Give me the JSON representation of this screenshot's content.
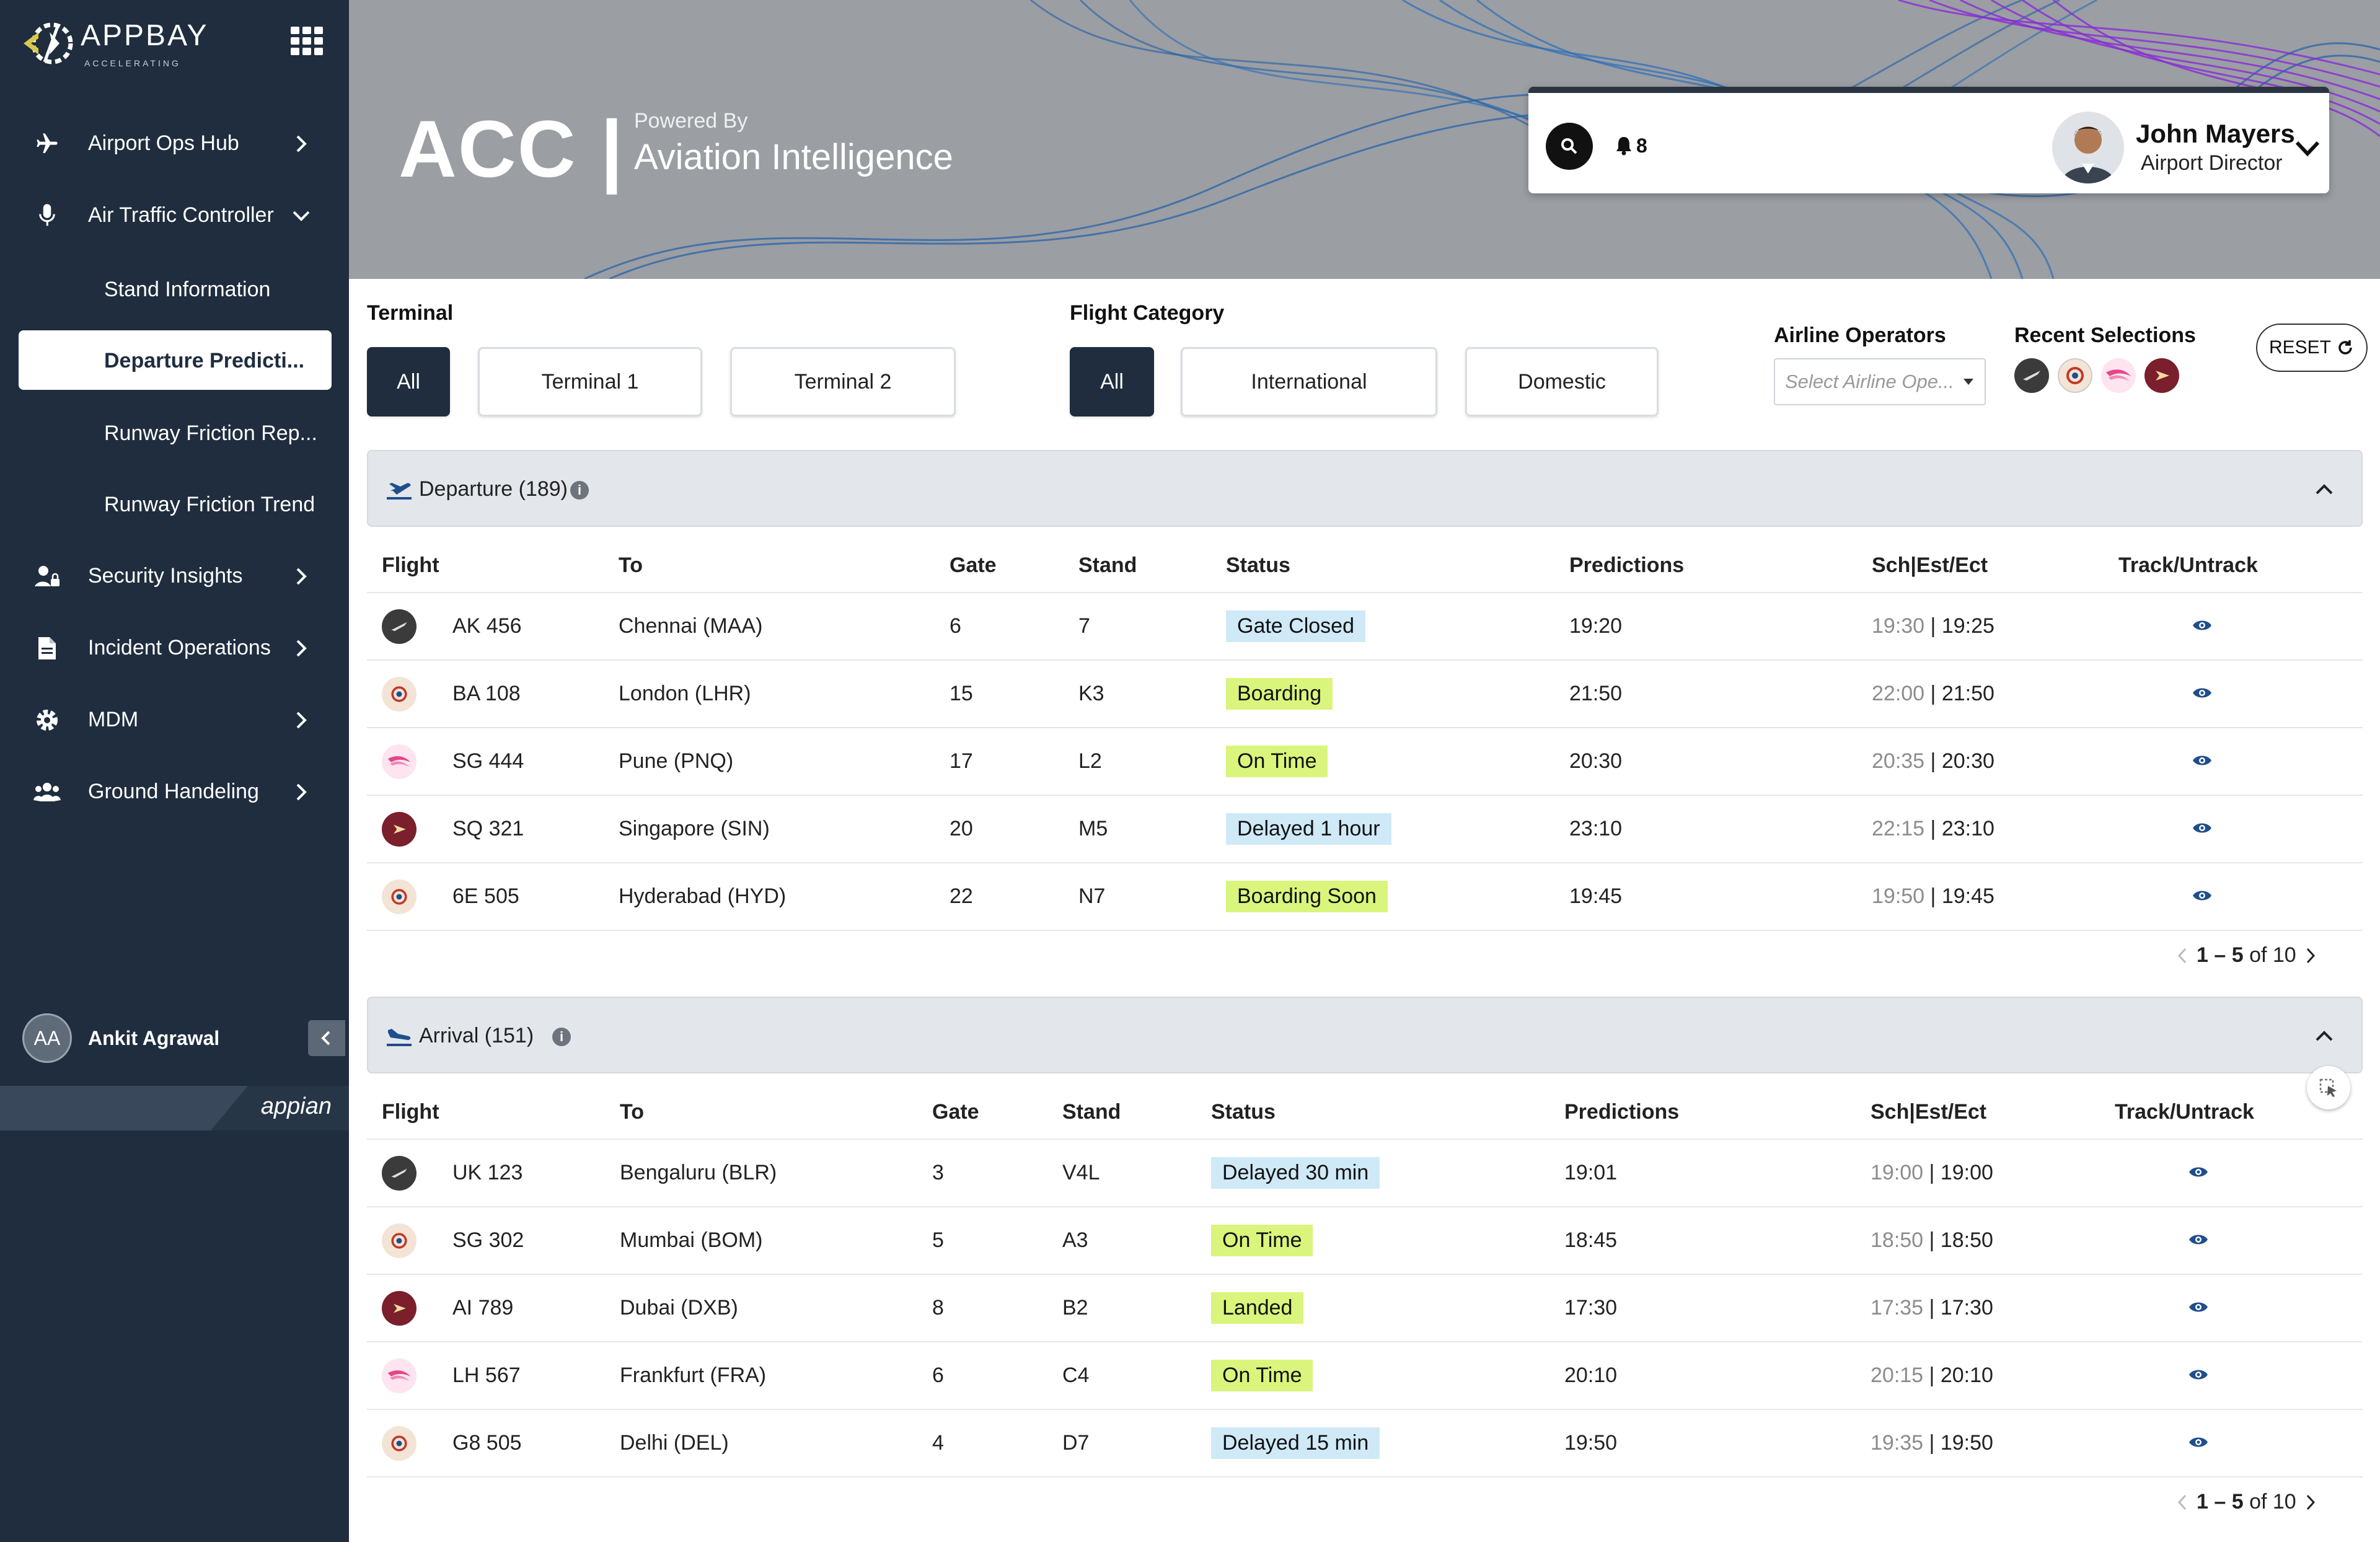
{
  "brand": {
    "name": "APPBAY",
    "tagline": "ACCELERATING"
  },
  "sidebar": {
    "items": [
      {
        "label": "Airport Ops Hub",
        "icon": "plane-icon",
        "chevron": "right"
      },
      {
        "label": "Air Traffic Controller",
        "icon": "microphone-icon",
        "chevron": "down"
      },
      {
        "label": "Security Insights",
        "icon": "user-lock-icon",
        "chevron": "right"
      },
      {
        "label": "Incident Operations",
        "icon": "document-icon",
        "chevron": "right"
      },
      {
        "label": "MDM",
        "icon": "gear-icon",
        "chevron": "right"
      },
      {
        "label": "Ground Handeling",
        "icon": "users-icon",
        "chevron": "right"
      }
    ],
    "sub_items": [
      {
        "label": "Stand Information",
        "active": false
      },
      {
        "label": "Departure Predicti...",
        "active": true
      },
      {
        "label": "Runway Friction Rep...",
        "active": false
      },
      {
        "label": "Runway Friction Trend",
        "active": false
      }
    ],
    "user": {
      "initials": "AA",
      "name": "Ankit Agrawal"
    },
    "footer_brand": "appian"
  },
  "header": {
    "title": "ACC |",
    "powered_by": "Powered By",
    "subtitle": "Aviation Intelligence",
    "notifications_count": "8",
    "user_name": "John Mayers",
    "user_role": "Airport Director"
  },
  "filters": {
    "terminal_label": "Terminal",
    "terminal_options": [
      "All",
      "Terminal 1",
      "Terminal 2"
    ],
    "terminal_selected": "All",
    "category_label": "Flight Category",
    "category_options": [
      "All",
      "International",
      "Domestic"
    ],
    "category_selected": "All",
    "airline_label": "Airline Operators",
    "airline_placeholder": "Select Airline Ope...",
    "recent_label": "Recent Selections",
    "reset_label": "RESET"
  },
  "columns": [
    "Flight",
    "To",
    "Gate",
    "Stand",
    "Status",
    "Predictions",
    "Sch|Est/Ect",
    "Track/Untrack"
  ],
  "departure": {
    "title": "Departure (189)",
    "rows": [
      {
        "airline": "dark",
        "flight": "AK 456",
        "to": "Chennai (MAA)",
        "gate": "6",
        "stand": "7",
        "status": "Gate Closed",
        "status_color": "blue",
        "prediction": "19:20",
        "sch": "19:30",
        "est": "19:25"
      },
      {
        "airline": "target",
        "flight": "BA 108",
        "to": "London (LHR)",
        "gate": "15",
        "stand": "K3",
        "status": "Boarding",
        "status_color": "green",
        "prediction": "21:50",
        "sch": "22:00",
        "est": "21:50"
      },
      {
        "airline": "pink",
        "flight": "SG 444",
        "to": "Pune (PNQ)",
        "gate": "17",
        "stand": "L2",
        "status": "On Time",
        "status_color": "green",
        "prediction": "20:30",
        "sch": "20:35",
        "est": "20:30"
      },
      {
        "airline": "maroon",
        "flight": "SQ 321",
        "to": "Singapore (SIN)",
        "gate": "20",
        "stand": "M5",
        "status": "Delayed 1 hour",
        "status_color": "blue",
        "prediction": "23:10",
        "sch": "22:15",
        "est": "23:10"
      },
      {
        "airline": "target",
        "flight": "6E 505",
        "to": "Hyderabad (HYD)",
        "gate": "22",
        "stand": "N7",
        "status": "Boarding Soon",
        "status_color": "green",
        "prediction": "19:45",
        "sch": "19:50",
        "est": "19:45"
      }
    ],
    "pager": {
      "range": "1 – 5",
      "total": "of 10"
    }
  },
  "arrival": {
    "title": "Arrival (151)",
    "rows": [
      {
        "airline": "dark",
        "flight": "UK 123",
        "to": "Bengaluru (BLR)",
        "gate": "3",
        "stand": "V4L",
        "status": "Delayed 30 min",
        "status_color": "blue",
        "prediction": "19:01",
        "sch": "19:00",
        "est": "19:00"
      },
      {
        "airline": "target",
        "flight": "SG 302",
        "to": "Mumbai (BOM)",
        "gate": "5",
        "stand": "A3",
        "status": "On Time",
        "status_color": "green",
        "prediction": "18:45",
        "sch": "18:50",
        "est": "18:50"
      },
      {
        "airline": "maroon",
        "flight": "AI 789",
        "to": "Dubai (DXB)",
        "gate": "8",
        "stand": "B2",
        "status": "Landed",
        "status_color": "green",
        "prediction": "17:30",
        "sch": "17:35",
        "est": "17:30"
      },
      {
        "airline": "pink",
        "flight": "LH 567",
        "to": "Frankfurt (FRA)",
        "gate": "6",
        "stand": "C4",
        "status": "On Time",
        "status_color": "green",
        "prediction": "20:10",
        "sch": "20:15",
        "est": "20:10"
      },
      {
        "airline": "target",
        "flight": "G8 505",
        "to": "Delhi (DEL)",
        "gate": "4",
        "stand": "D7",
        "status": "Delayed 15 min",
        "status_color": "blue",
        "prediction": "19:50",
        "sch": "19:35",
        "est": "19:50"
      }
    ],
    "pager": {
      "range": "1 – 5",
      "total": "of 10"
    }
  },
  "colors": {
    "sidebar": "#1f2d3e",
    "status_blue": "#cfe9f7",
    "status_green": "#d9f57c",
    "accent_blue": "#1f4e8c",
    "wave_purple": "#8a2bd6"
  }
}
